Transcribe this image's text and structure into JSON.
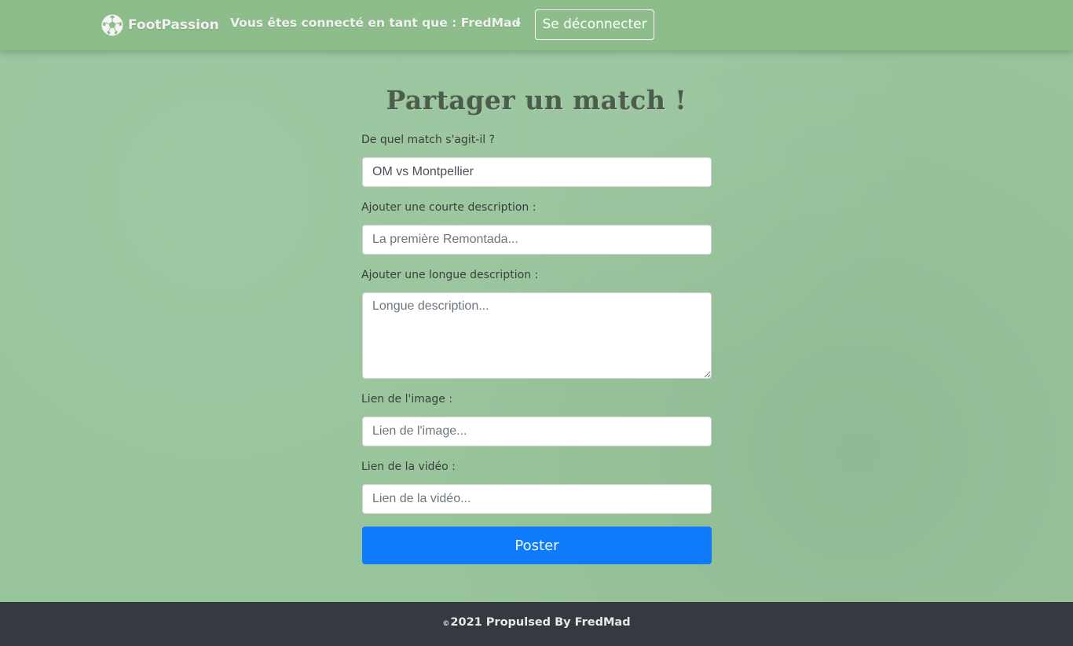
{
  "navbar": {
    "brand": "FootPassion",
    "user_info": "Vous êtes connecté en tant que : FredMad",
    "separator": "-",
    "logout_label": "Se déconnecter"
  },
  "form": {
    "title": "Partager un match !",
    "match_label": "De quel match s'agit-il ?",
    "match_value": "OM vs Montpellier",
    "short_desc_label": "Ajouter une courte description :",
    "short_desc_placeholder": "La première Remontada...",
    "long_desc_label": "Ajouter une longue description :",
    "long_desc_placeholder": "Longue description...",
    "image_label": "Lien de l'image :",
    "image_placeholder": "Lien de l'image...",
    "video_label": "Lien de la vidéo :",
    "video_placeholder": "Lien de la vidéo...",
    "submit_label": "Poster"
  },
  "footer": {
    "copyright_symbol": "©",
    "text": "2021 Propulsed By FredMad"
  },
  "colors": {
    "page_background": "#98c49b",
    "navbar_background": "#8dbd8a",
    "submit_button": "#0d7bfa",
    "footer_background": "#343a40"
  },
  "icons": {
    "brand": "soccer-ball-icon"
  }
}
